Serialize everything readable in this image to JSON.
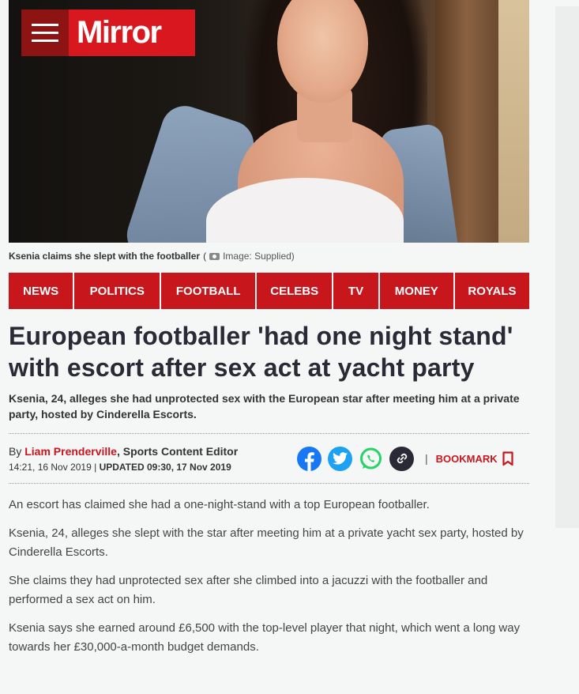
{
  "brand": {
    "name": "Mirror",
    "color": "#d8181e",
    "dark": "#8e1414"
  },
  "image": {
    "caption": "Ksenia claims she slept with the footballer",
    "credit_prefix": "(",
    "credit": "Image: Supplied)"
  },
  "nav": [
    "NEWS",
    "POLITICS",
    "FOOTBALL",
    "CELEBS",
    "TV",
    "MONEY",
    "ROYALS"
  ],
  "article": {
    "headline": "European footballer 'had one night stand' with escort after sex act at yacht party",
    "standfirst": "Ksenia, 24, alleges she had unprotected sex with the European star after meeting him at a private party, hosted by Cinderella Escorts.",
    "by_prefix": "By ",
    "author": "Liam Prenderville",
    "role": ", Sports Content Editor",
    "published": "14:21, 16 Nov 2019",
    "divider": "|",
    "updated": "UPDATED 09:30, 17 Nov 2019",
    "bookmark": "BOOKMARK",
    "paragraphs": [
      "An escort has claimed she had a one-night-stand with a top European footballer.",
      "Ksenia, 24, alleges she slept with the star after meeting him at a private yacht sex party, hosted by Cinderella Escorts.",
      "She claims they had unprotected sex after she climbed into a jacuzzi with the footballer and performed a sex act on him.",
      "Ksenia says she earned around £6,500 with the top-level player that night, which went a long way towards her £30,000-a-month budget demands."
    ]
  },
  "share": {
    "facebook_color": "#1877f2",
    "twitter_color": "#1da1f2",
    "whatsapp_color": "#25d366",
    "link_color": "#2a2a36"
  }
}
